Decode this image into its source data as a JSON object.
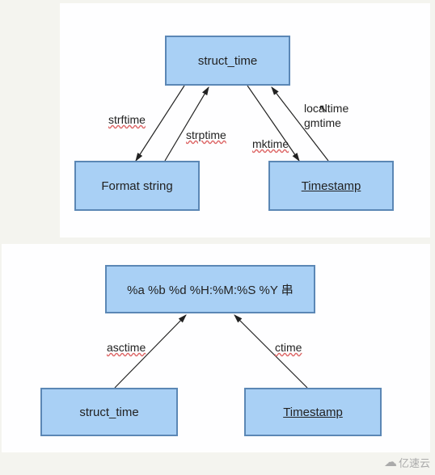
{
  "diagram1": {
    "nodes": {
      "top": "struct_time",
      "bottom_left": "Format string",
      "bottom_right": "Timestamp"
    },
    "edges": {
      "strftime": "strftime",
      "strptime": "strptime",
      "mktime": "mktime",
      "localtime": "localtime",
      "gmtime": "gmtime"
    }
  },
  "diagram2": {
    "nodes": {
      "top": "%a %b %d %H:%M:%S %Y 串",
      "bottom_left": "struct_time",
      "bottom_right": "Timestamp"
    },
    "edges": {
      "asctime": "asctime",
      "ctime": "ctime"
    }
  },
  "watermark": "亿速云"
}
